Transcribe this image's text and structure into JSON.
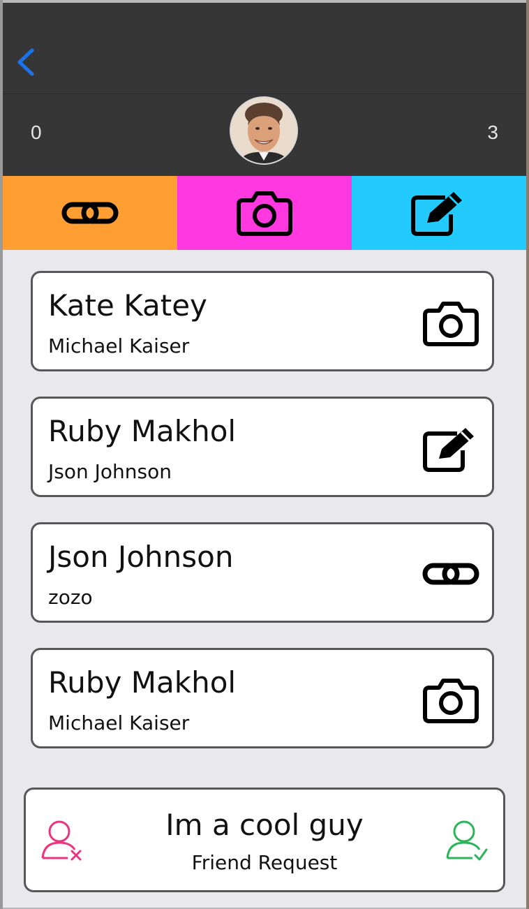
{
  "header": {
    "back_icon": "chevron-left-icon",
    "left_count": "0",
    "right_count": "3",
    "avatar": "profile-avatar"
  },
  "tabs": [
    {
      "icon": "link-icon",
      "color": "#ff9f33"
    },
    {
      "icon": "camera-icon",
      "color": "#ff38df"
    },
    {
      "icon": "edit-icon",
      "color": "#23cafd"
    }
  ],
  "cards": [
    {
      "title": "Kate Katey",
      "subtitle": "Michael Kaiser",
      "icon": "camera-icon"
    },
    {
      "title": "Ruby Makhol",
      "subtitle": "Json Johnson",
      "icon": "edit-icon"
    },
    {
      "title": "Json Johnson",
      "subtitle": "zozo",
      "icon": "link-icon"
    },
    {
      "title": "Ruby Makhol",
      "subtitle": "Michael Kaiser",
      "icon": "camera-icon"
    }
  ],
  "request": {
    "title": "Im a cool guy",
    "subtitle": "Friend Request",
    "decline_icon": "remove-user-icon",
    "accept_icon": "accept-user-icon",
    "decline_color": "#e8357d",
    "accept_color": "#2db45a"
  },
  "colors": {
    "header_bg": "#363636",
    "back_accent": "#1a73e8",
    "page_bg": "#e9e8ed"
  }
}
